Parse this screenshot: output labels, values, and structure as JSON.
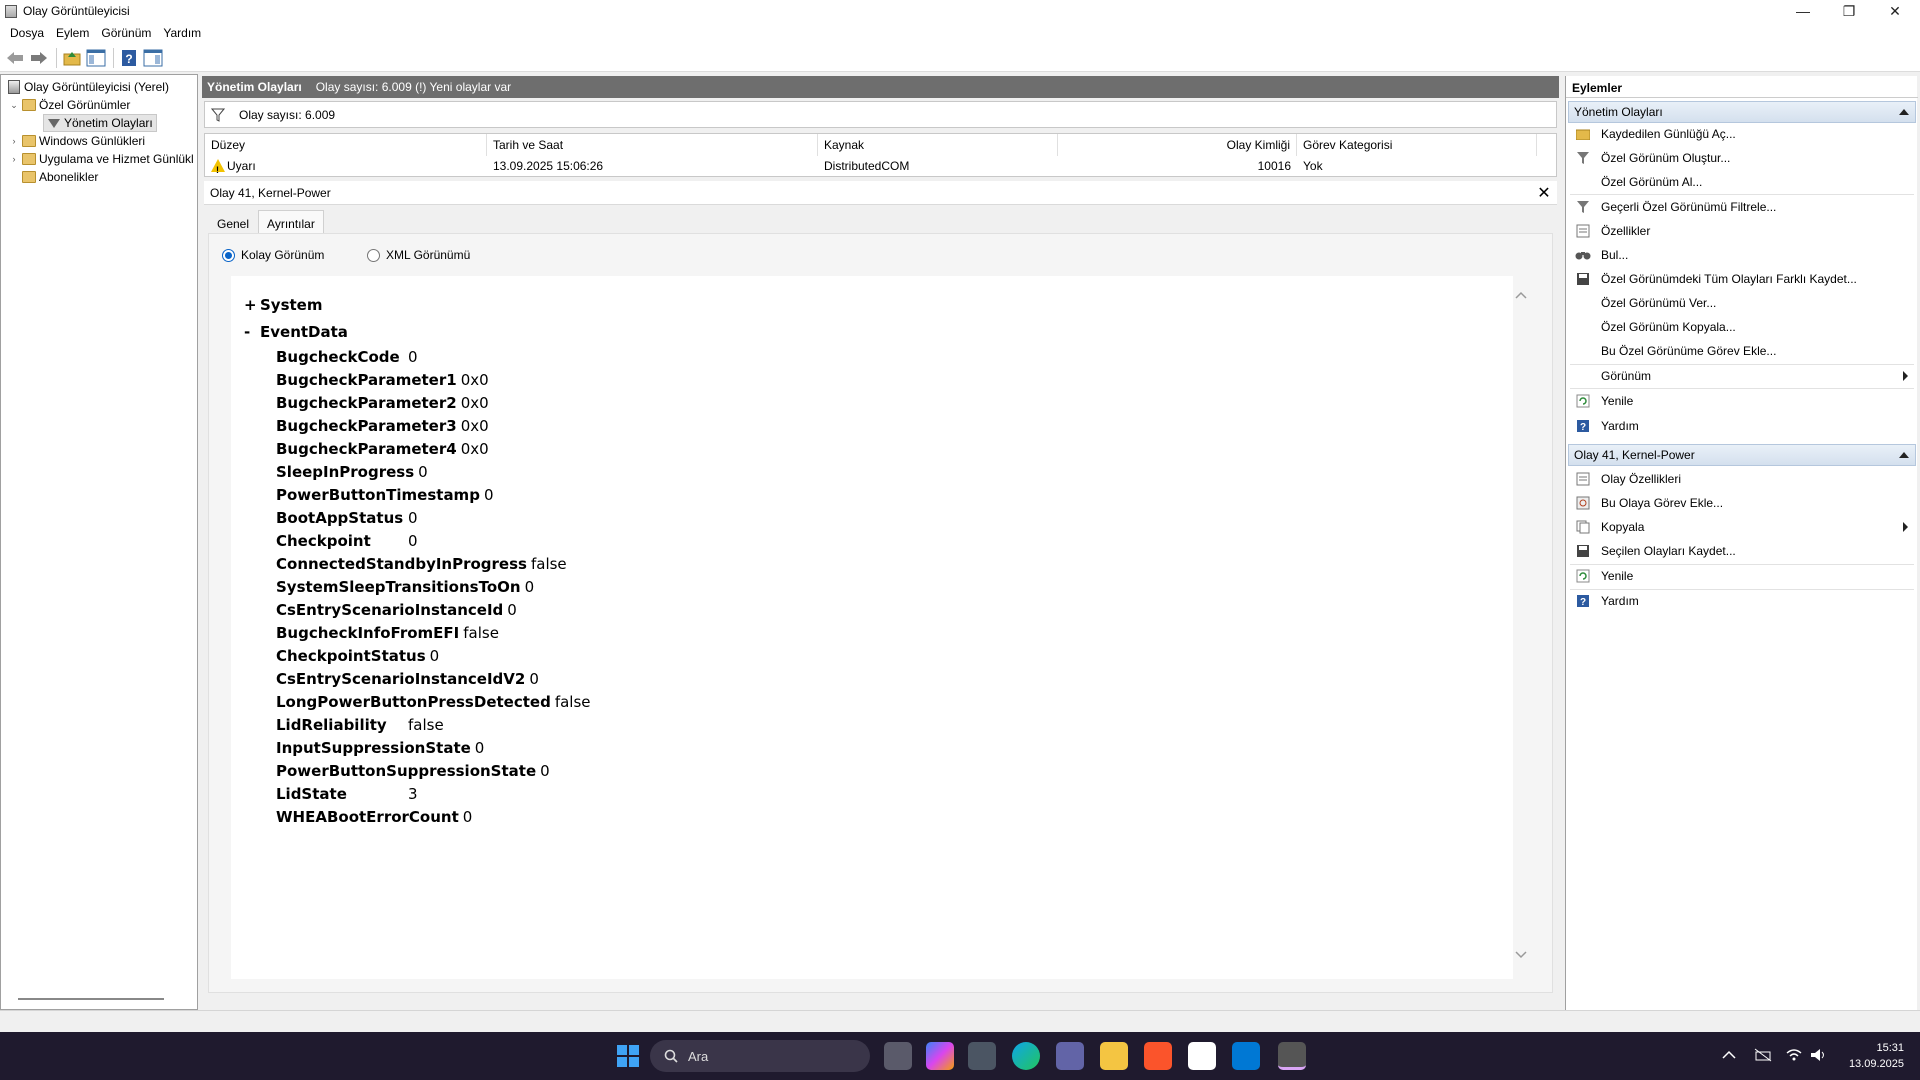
{
  "window": {
    "title": "Olay Görüntüleyicisi",
    "minimize_glyph": "—",
    "restore_glyph": "❐",
    "close_glyph": "✕"
  },
  "menu": [
    "Dosya",
    "Eylem",
    "Görünüm",
    "Yardım"
  ],
  "tree": {
    "root": "Olay Görüntüleyicisi (Yerel)",
    "custom_views": "Özel Görünümler",
    "admin_events": "Yönetim Olayları",
    "windows_logs": "Windows Günlükleri",
    "app_service_logs": "Uygulama ve Hizmet Günlükl",
    "subscriptions": "Abonelikler"
  },
  "center": {
    "header_title": "Yönetim Olayları",
    "header_info": "Olay sayısı: 6.009 (!) Yeni olaylar var",
    "filter_text": "Olay sayısı: 6.009",
    "columns": [
      "Düzey",
      "Tarih ve Saat",
      "Kaynak",
      "Olay Kimliği",
      "Görev Kategorisi"
    ],
    "row": {
      "level": "Uyarı",
      "datetime": "13.09.2025 15:06:26",
      "source": "DistributedCOM",
      "event_id": "10016",
      "task_category": "Yok"
    }
  },
  "details": {
    "title": "Olay 41, Kernel-Power",
    "close_glyph": "✕",
    "tabs": [
      "Genel",
      "Ayrıntılar"
    ],
    "radio_friendly": "Kolay Görünüm",
    "radio_xml": "XML Görünümü",
    "system_sign": "+",
    "system_label": "System",
    "eventdata_sign": "-",
    "eventdata_label": "EventData",
    "fields": [
      {
        "k": "BugcheckCode",
        "v": "0"
      },
      {
        "k": "BugcheckParameter1",
        "v": "0x0"
      },
      {
        "k": "BugcheckParameter2",
        "v": "0x0"
      },
      {
        "k": "BugcheckParameter3",
        "v": "0x0"
      },
      {
        "k": "BugcheckParameter4",
        "v": "0x0"
      },
      {
        "k": "SleepInProgress",
        "v": "0"
      },
      {
        "k": "PowerButtonTimestamp",
        "v": "0"
      },
      {
        "k": "BootAppStatus",
        "v": "0"
      },
      {
        "k": "Checkpoint",
        "v": "0"
      },
      {
        "k": "ConnectedStandbyInProgress",
        "v": "false"
      },
      {
        "k": "SystemSleepTransitionsToOn",
        "v": "0"
      },
      {
        "k": "CsEntryScenarioInstanceId",
        "v": "0"
      },
      {
        "k": "BugcheckInfoFromEFI",
        "v": "false"
      },
      {
        "k": "CheckpointStatus",
        "v": "0"
      },
      {
        "k": "CsEntryScenarioInstanceIdV2",
        "v": "0"
      },
      {
        "k": "LongPowerButtonPressDetected",
        "v": "false"
      },
      {
        "k": "LidReliability",
        "v": "false"
      },
      {
        "k": "InputSuppressionState",
        "v": "0"
      },
      {
        "k": "PowerButtonSuppressionState",
        "v": "0"
      },
      {
        "k": "LidState",
        "v": "3"
      },
      {
        "k": "WHEABootErrorCount",
        "v": "0"
      }
    ]
  },
  "actions": {
    "title": "Eylemler",
    "group1": "Yönetim Olayları",
    "group1_items": [
      "Kaydedilen Günlüğü Aç...",
      "Özel Görünüm Oluştur...",
      "Özel Görünüm Al...",
      "Geçerli Özel Görünümü Filtrele...",
      "Özellikler",
      "Bul...",
      "Özel Görünümdeki Tüm Olayları Farklı Kaydet...",
      "Özel Görünümü Ver...",
      "Özel Görünüm Kopyala...",
      "Bu Özel Görünüme Görev Ekle...",
      "Görünüm",
      "Yenile",
      "Yardım"
    ],
    "group2": "Olay 41, Kernel-Power",
    "group2_items": [
      "Olay Özellikleri",
      "Bu Olaya Görev Ekle...",
      "Kopyala",
      "Seçilen Olayları Kaydet...",
      "Yenile",
      "Yardım"
    ]
  },
  "taskbar": {
    "search_placeholder": "Ara",
    "time": "15:31",
    "date": "13.09.2025"
  },
  "colors": {
    "accent": "#0a64c8",
    "header_gray": "#6e6e6e",
    "taskbar": "#1f1a2e"
  }
}
